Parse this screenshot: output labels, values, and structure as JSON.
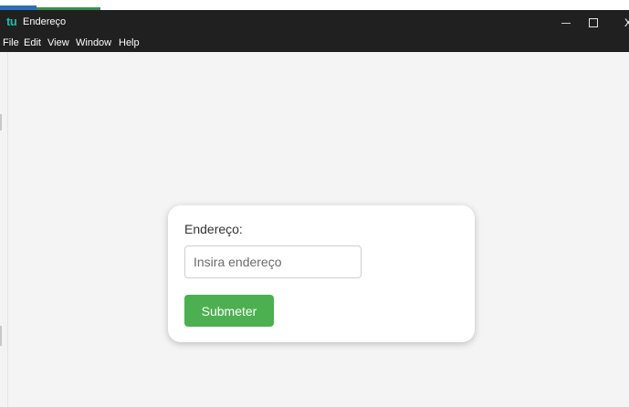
{
  "window": {
    "logo_text": "tu",
    "title": "Endereço",
    "controls": {
      "minimize_icon": "minimize-icon",
      "maximize_icon": "maximize-icon",
      "close_icon": "close-icon",
      "close_glyph": "X"
    }
  },
  "menu": {
    "items": [
      "File",
      "Edit",
      "View",
      "Window",
      "Help"
    ]
  },
  "form": {
    "label": "Endereço:",
    "input_value": "",
    "input_placeholder": "Insira endereço",
    "submit_label": "Submeter"
  },
  "colors": {
    "titlebar": "#202020",
    "logo_accent": "#1fb8a8",
    "background": "#f4f4f4",
    "card": "#ffffff",
    "submit_button": "#4caf50"
  }
}
